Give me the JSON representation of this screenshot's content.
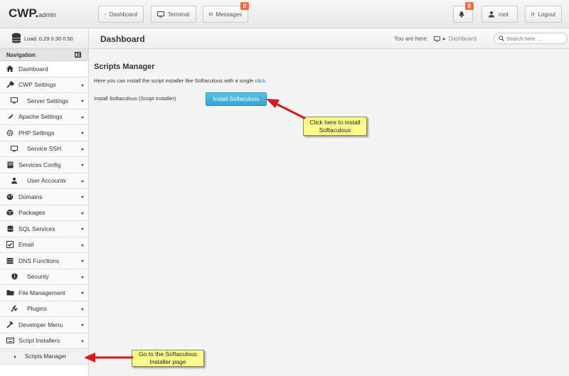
{
  "app": {
    "logo_main": "CWP.",
    "logo_sub": "admin"
  },
  "topnav": {
    "dashboard": "Dashboard",
    "terminal": "Terminal",
    "messages": "Messages",
    "messages_badge": "0",
    "notifications_badge": "0",
    "user": "root",
    "logout": "Logout"
  },
  "sidebar": {
    "load_text": "Load: 0.29  0.30  0.50",
    "nav_title": "Navigation",
    "items": [
      {
        "label": "Dashboard",
        "icon": "home-icon",
        "caret": false
      },
      {
        "label": "CWP Settings",
        "icon": "tools-icon",
        "caret": true
      },
      {
        "label": "Server Settings",
        "icon": "monitor-icon",
        "caret": true
      },
      {
        "label": "Apache Settings",
        "icon": "feather-icon",
        "caret": true
      },
      {
        "label": "PHP Settings",
        "icon": "gear-icon",
        "caret": true
      },
      {
        "label": "Service SSH",
        "icon": "monitor-icon",
        "caret": true
      },
      {
        "label": "Services Config",
        "icon": "server-icon",
        "caret": true
      },
      {
        "label": "User Accounts",
        "icon": "user-icon",
        "caret": true
      },
      {
        "label": "Domains",
        "icon": "globe-icon",
        "caret": true
      },
      {
        "label": "Packages",
        "icon": "cube-icon",
        "caret": true
      },
      {
        "label": "SQL Services",
        "icon": "database-icon",
        "caret": true
      },
      {
        "label": "Email",
        "icon": "email-icon",
        "caret": true
      },
      {
        "label": "DNS Functions",
        "icon": "dns-icon",
        "caret": true
      },
      {
        "label": "Security",
        "icon": "shield-icon",
        "caret": true
      },
      {
        "label": "File Management",
        "icon": "folder-icon",
        "caret": true
      },
      {
        "label": "Plugins",
        "icon": "plug-icon",
        "caret": true
      },
      {
        "label": "Developer Menu",
        "icon": "hammer-icon",
        "caret": true
      },
      {
        "label": "Script Installers",
        "icon": "keyboard-icon",
        "caret": true
      }
    ],
    "subitem": "Scripts Manager"
  },
  "header": {
    "title": "Dashboard",
    "you_are_here": "You are here:",
    "crumb": "Dashboard",
    "search_placeholder": "Search here ..."
  },
  "main": {
    "title": "Scripts Manager",
    "desc_before": "Here you can install the script installer like Softaculous with a single ",
    "desc_link": "click",
    "desc_after": ".",
    "install_label": "Install Softaculous (Script Installer)",
    "install_button": "Install Softaculous"
  },
  "callouts": {
    "install_line1": "Click here to install",
    "install_line2": "Softaculous",
    "goto_line1": "Go to the Softaculous",
    "goto_line2": "Installer page"
  },
  "colors": {
    "button": "#35a4d3",
    "badge": "#ef6f3a",
    "callout": "#fbfb8c",
    "arrow": "#d11a1a"
  }
}
